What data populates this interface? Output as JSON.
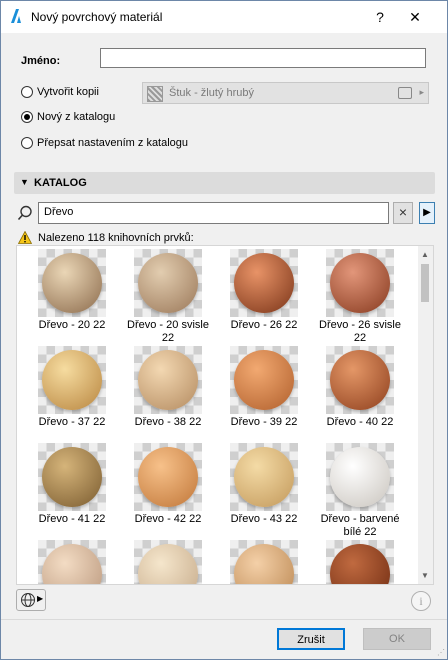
{
  "window": {
    "title": "Nový povrchový materiál",
    "help": "?",
    "close": "✕"
  },
  "form": {
    "name_label": "Jméno:",
    "name_value": "",
    "options": [
      {
        "label": "Vytvořit kopii",
        "checked": false
      },
      {
        "label": "Nový z katalogu",
        "checked": true
      },
      {
        "label": "Přepsat nastavením z katalogu",
        "checked": false
      }
    ],
    "copy_source": "Štuk - žlutý hrubý"
  },
  "catalog": {
    "section_title": "KATALOG",
    "search_value": "Dřevo",
    "status": "Nalezeno 118 knihovních prvků:",
    "items": [
      {
        "label": "Dřevo - 20 22",
        "colors": [
          "#ead6b6",
          "#8b6a4b"
        ]
      },
      {
        "label": "Dřevo - 20 svisle 22",
        "colors": [
          "#e2cdb0",
          "#9a7758"
        ]
      },
      {
        "label": "Dřevo - 26 22",
        "colors": [
          "#e89367",
          "#7a3418"
        ]
      },
      {
        "label": "Dřevo - 26 svisle 22",
        "colors": [
          "#e2967a",
          "#86391e"
        ]
      },
      {
        "label": "Dřevo - 37 22",
        "colors": [
          "#f6dca0",
          "#b8853f"
        ]
      },
      {
        "label": "Dřevo - 38 22",
        "colors": [
          "#f3d8b2",
          "#b38a5f"
        ]
      },
      {
        "label": "Dřevo - 39 22",
        "colors": [
          "#f2a971",
          "#b05f2c"
        ]
      },
      {
        "label": "Dřevo - 40 22",
        "colors": [
          "#e49767",
          "#8e3f1d"
        ]
      },
      {
        "label": "Dřevo - 41 22",
        "colors": [
          "#d5b47a",
          "#7a5b2f"
        ]
      },
      {
        "label": "Dřevo - 42 22",
        "colors": [
          "#f7c18a",
          "#c07638"
        ]
      },
      {
        "label": "Dřevo - 43 22",
        "colors": [
          "#f4dba6",
          "#c2985a"
        ]
      },
      {
        "label": "Dřevo - barvené bílé 22",
        "colors": [
          "#ffffff",
          "#c9c4bd"
        ]
      },
      {
        "label": "",
        "colors": [
          "#f3dcc4",
          "#b8957a"
        ]
      },
      {
        "label": "",
        "colors": [
          "#f5e6cc",
          "#c4a887"
        ]
      },
      {
        "label": "",
        "colors": [
          "#f4d0a8",
          "#b9854f"
        ]
      },
      {
        "label": "",
        "colors": [
          "#c06a40",
          "#6e2a10"
        ]
      }
    ]
  },
  "footer": {
    "info": "i",
    "cancel_label": "Zrušit",
    "ok_label": "OK"
  }
}
